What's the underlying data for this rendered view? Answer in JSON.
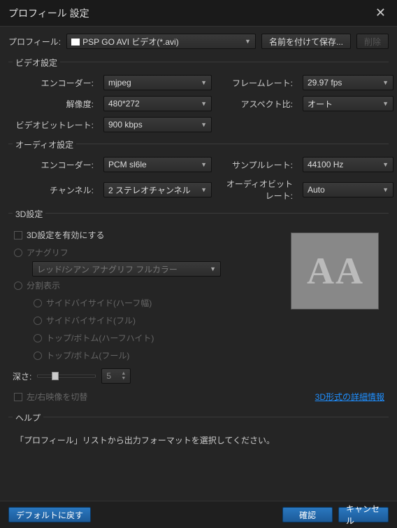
{
  "titlebar": {
    "title": "プロフィール 設定"
  },
  "top": {
    "profile_label": "プロフィール:",
    "profile_value": "PSP GO AVI ビデオ(*.avi)",
    "save_as": "名前を付けて保存...",
    "delete": "削除"
  },
  "video": {
    "group_title": "ビデオ設定",
    "encoder_label": "エンコーダー:",
    "encoder_value": "mjpeg",
    "framerate_label": "フレームレート:",
    "framerate_value": "29.97 fps",
    "res_label": "解像度:",
    "res_value": "480*272",
    "aspect_label": "アスペクト比:",
    "aspect_value": "オート",
    "bitrate_label": "ビデオビットレート:",
    "bitrate_value": "900 kbps"
  },
  "audio": {
    "group_title": "オーディオ設定",
    "encoder_label": "エンコーダー:",
    "encoder_value": "PCM sl6le",
    "samplerate_label": "サンプルレート:",
    "samplerate_value": "44100 Hz",
    "channel_label": "チャンネル:",
    "channel_value": "2 ステレオチャンネル",
    "bitrate_label": "オーディオビットレート:",
    "bitrate_value": "Auto"
  },
  "threed": {
    "group_title": "3D設定",
    "enable_label": "3D設定を有効にする",
    "anaglyph_label": "アナグリフ",
    "anaglyph_value": "レッド/シアン アナグリフ フルカラー",
    "split_label": "分割表示",
    "sbs_half": "サイドバイサイド(ハーフ幅)",
    "sbs_full": "サイドバイサイド(フル)",
    "tb_half": "トップ/ボトム(ハーフハイト)",
    "tb_full": "トップ/ボトム(フール)",
    "depth_label": "深さ:",
    "depth_value": "5",
    "swap_label": "左/右映像を切替",
    "link": "3D形式の詳細情報"
  },
  "help": {
    "group_title": "ヘルプ",
    "text": "「プロフィール」リストから出力フォーマットを選択してください。"
  },
  "footer": {
    "default": "デフォルトに戻す",
    "ok": "確認",
    "cancel": "キャンセル"
  }
}
